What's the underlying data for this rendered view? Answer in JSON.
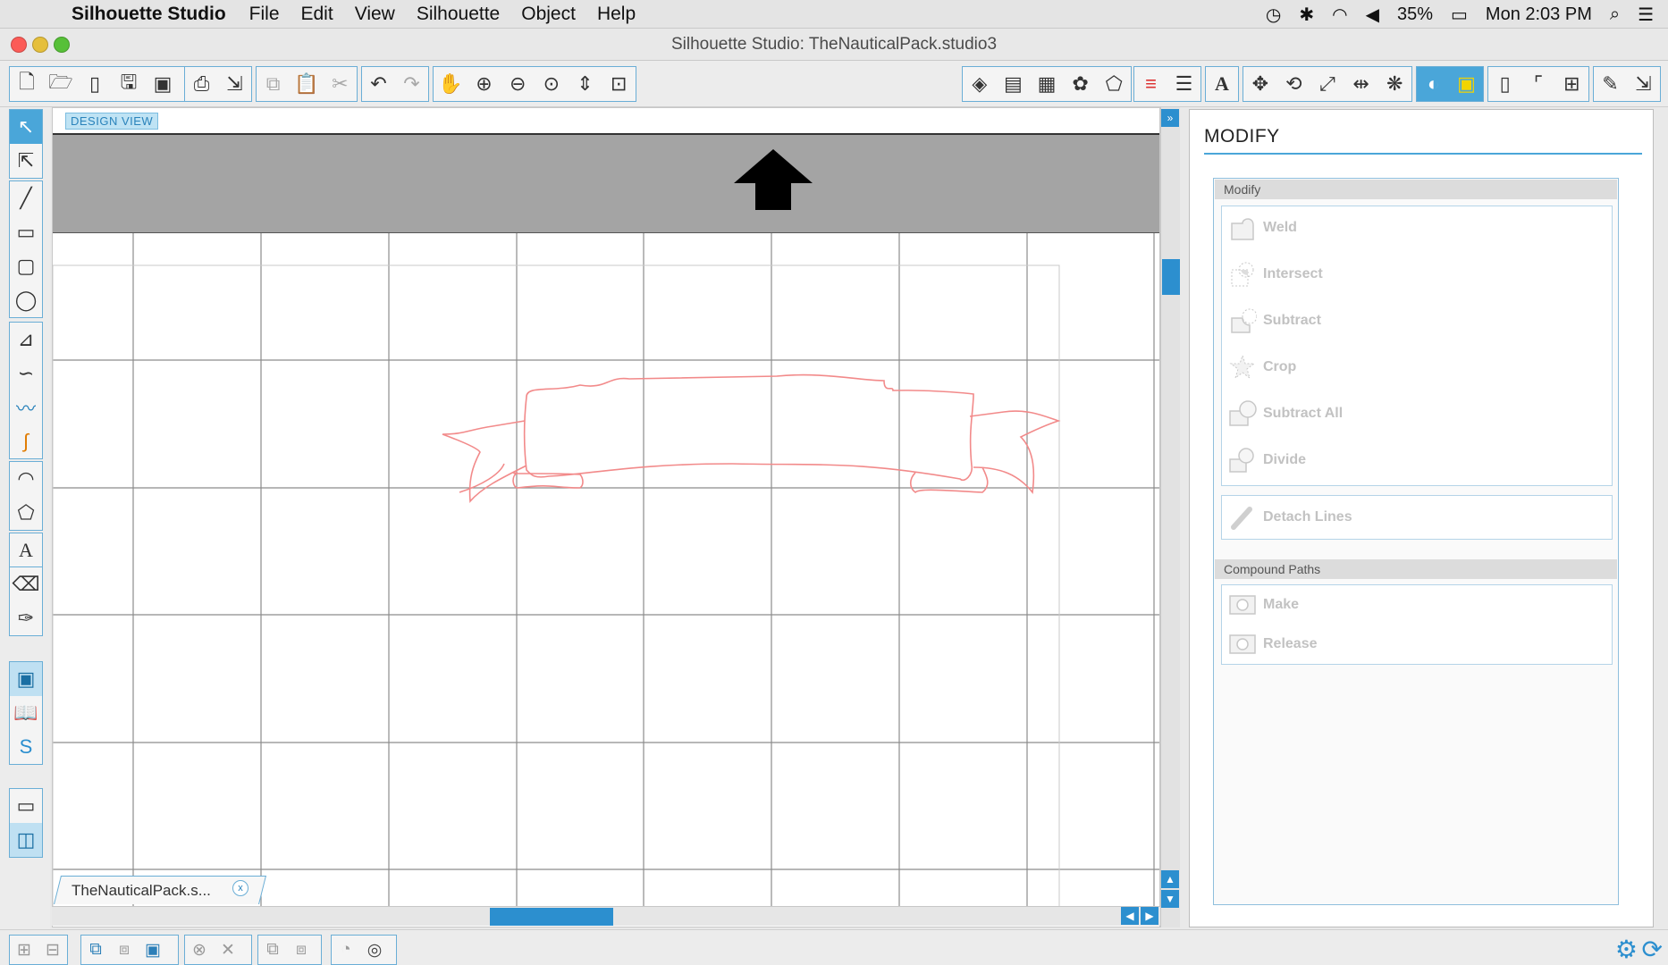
{
  "menubar": {
    "app_name": "Silhouette Studio",
    "items": [
      "File",
      "Edit",
      "View",
      "Silhouette",
      "Object",
      "Help"
    ],
    "battery": "35%",
    "clock": "Mon 2:03 PM"
  },
  "window": {
    "title": "Silhouette Studio: TheNauticalPack.studio3"
  },
  "canvas": {
    "view_label": "DESIGN VIEW",
    "document_tab": "TheNauticalPack.s...",
    "document_tab_close": "x",
    "shape_color": "#f28a8a"
  },
  "panel": {
    "title": "MODIFY",
    "modify_header": "Modify",
    "modify_items": [
      "Weld",
      "Intersect",
      "Subtract",
      "Crop",
      "Subtract All",
      "Divide"
    ],
    "detach_label": "Detach Lines",
    "compound_header": "Compound Paths",
    "compound_items": [
      "Make",
      "Release"
    ]
  },
  "colors": {
    "accent": "#4aa6d9",
    "scroll": "#2c8fcf",
    "disabled_text": "#c2c2c2"
  }
}
